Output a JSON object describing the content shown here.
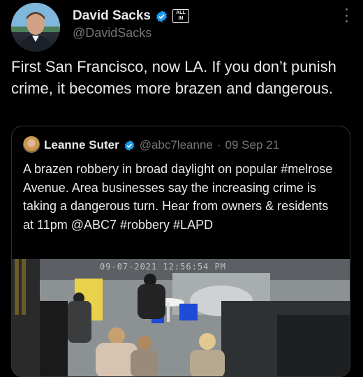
{
  "author": {
    "display_name": "David Sacks",
    "handle": "@DavidSacks",
    "affiliation_badge": [
      "ALL",
      "IN"
    ],
    "verified_color": "#1d9bf0"
  },
  "tweet": {
    "text": "First San Francisco, now LA. If you don’t punish crime, it becomes more brazen and dangerous."
  },
  "quoted_tweet": {
    "author_name": "Leanne Suter",
    "handle": "@abc7leanne",
    "separator": "·",
    "date": "09 Sep 21",
    "text": "A brazen robbery in broad daylight on popular #melrose Avenue. Area businesses say the increasing crime is taking a dangerous turn. Hear from owners & residents at 11pm @ABC7 #robbery #LAPD",
    "media": {
      "timestamp_overlay": "09-07-2021 12:56:54 PM",
      "icon": "surveillance-video-thumbnail"
    }
  },
  "icons": {
    "more": "more-options-icon",
    "verified": "verified-badge-icon"
  }
}
